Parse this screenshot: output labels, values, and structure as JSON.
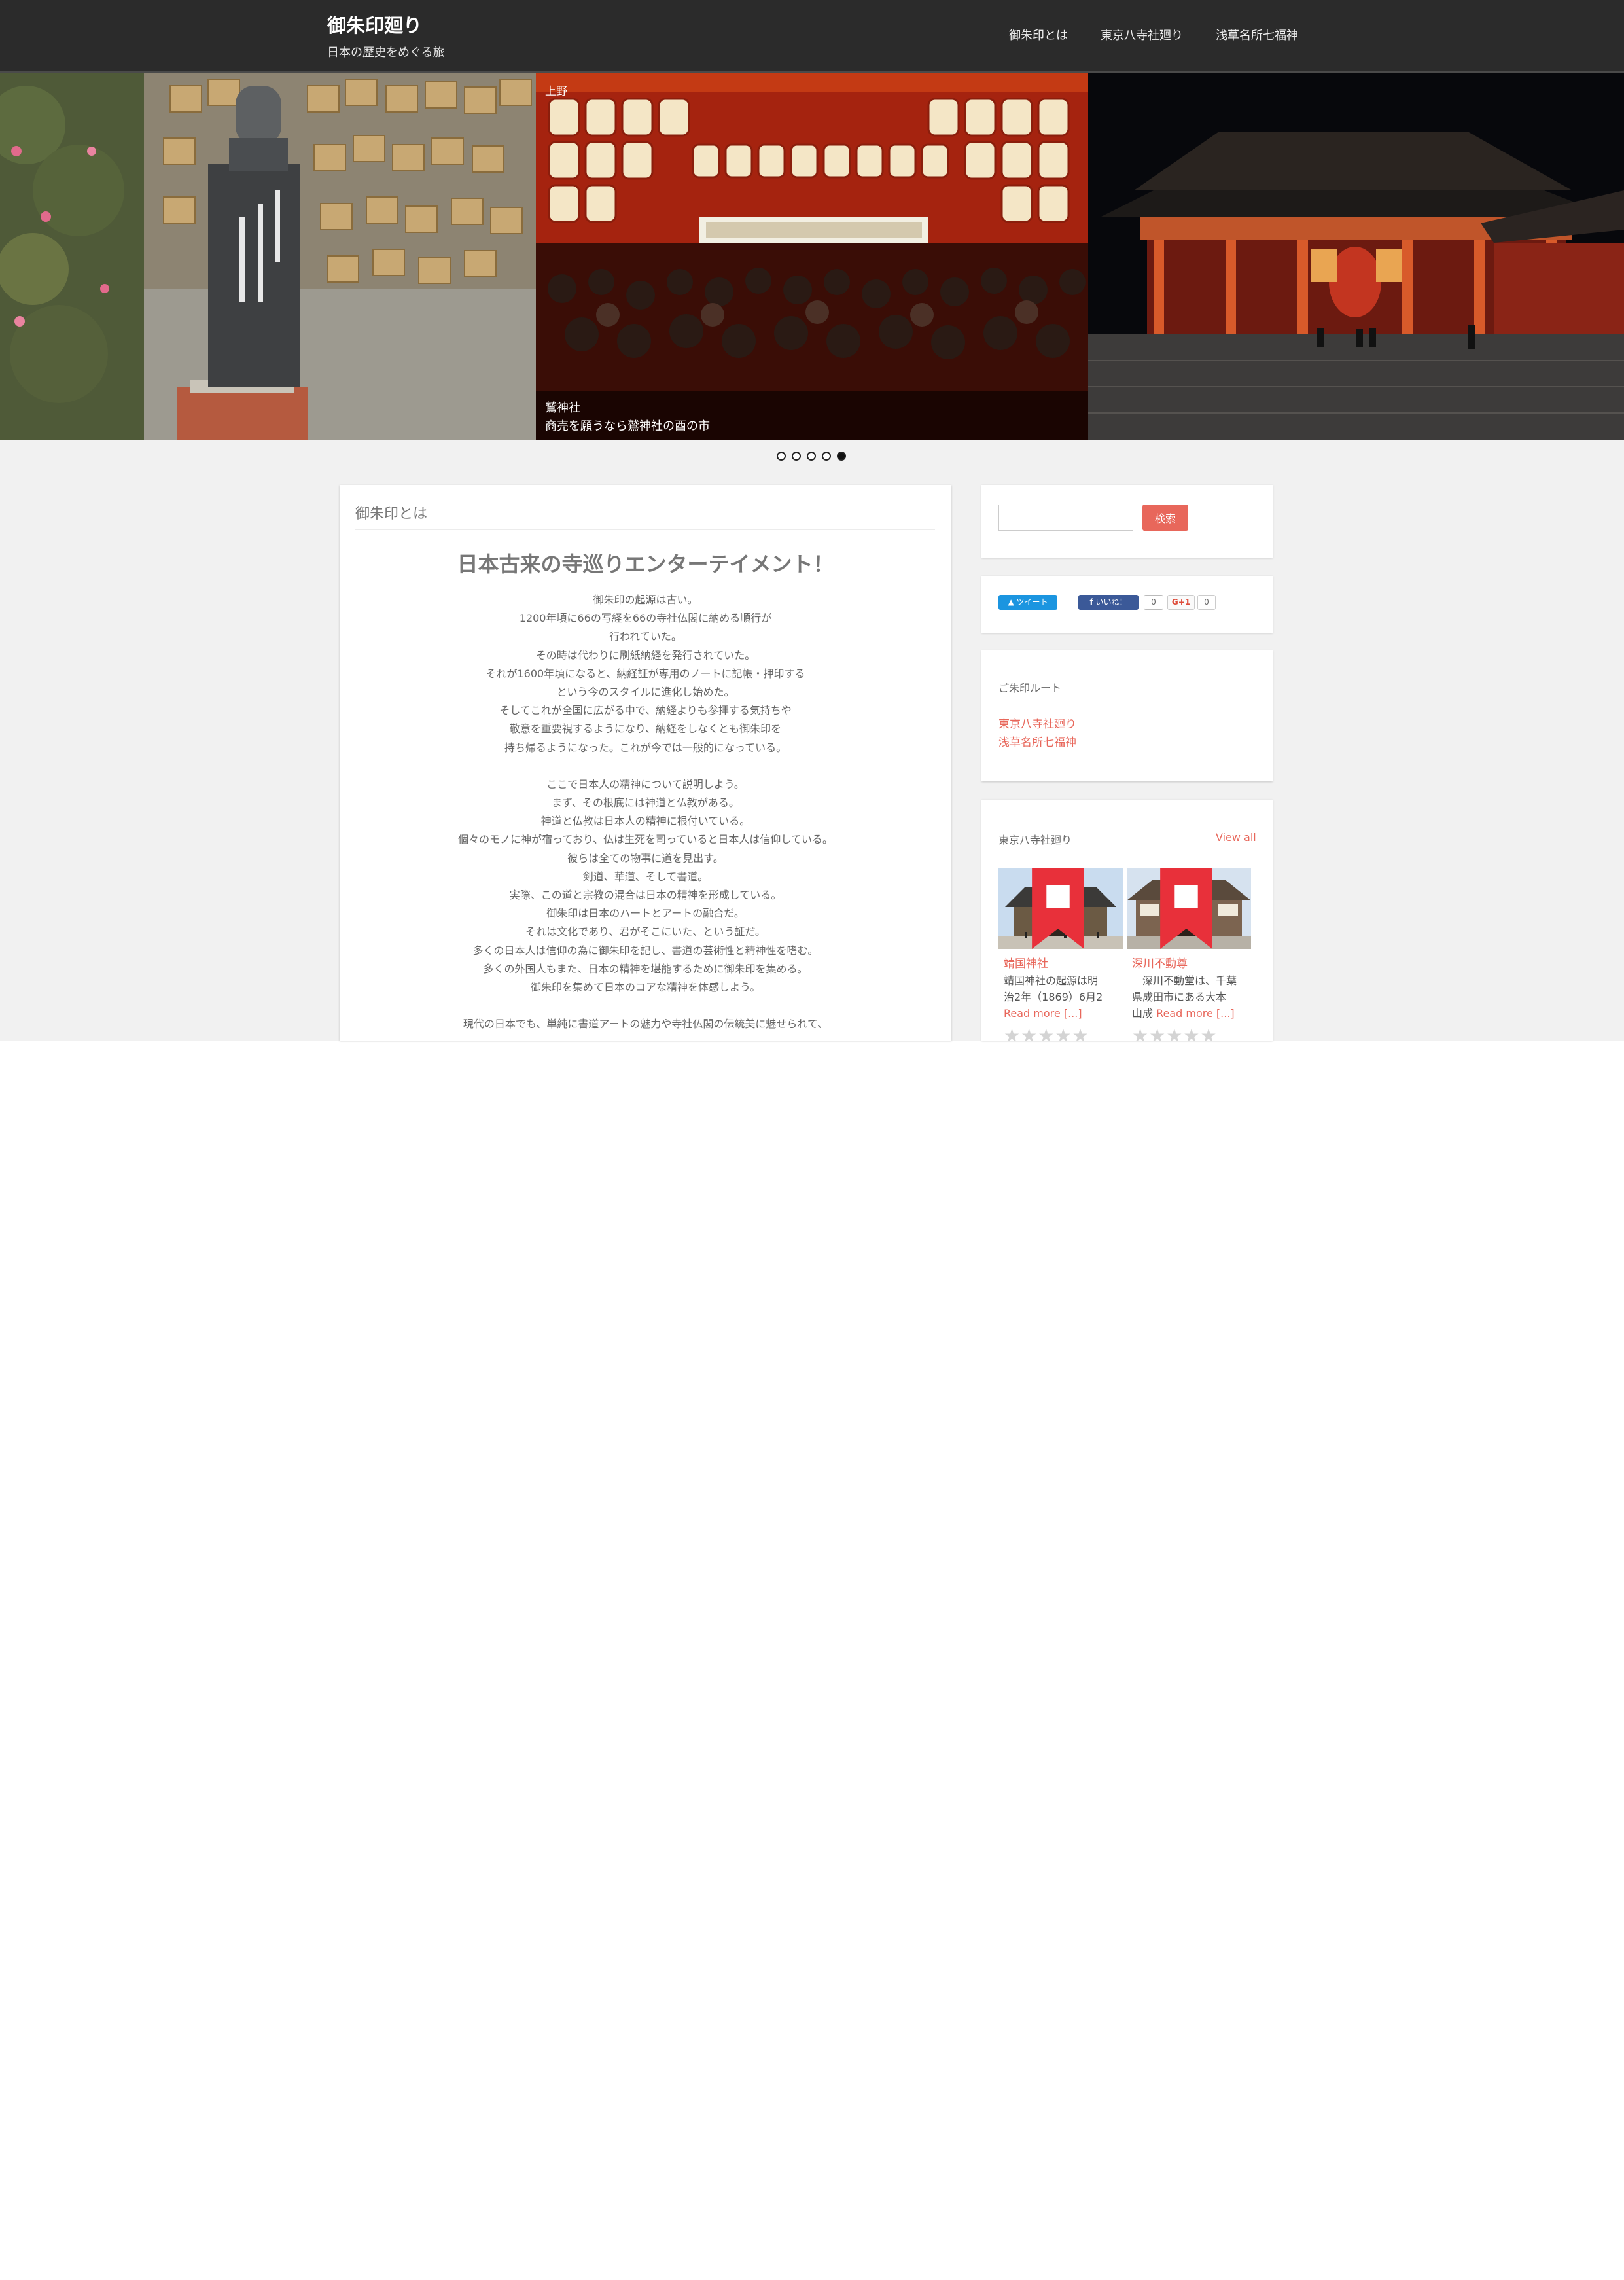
{
  "site": {
    "title": "御朱印廻り",
    "description": "日本の歴史をめぐる旅"
  },
  "nav": {
    "items": [
      {
        "label": "御朱印とは"
      },
      {
        "label": "東京八寺社廻り"
      },
      {
        "label": "浅草名所七福神"
      }
    ]
  },
  "slider": {
    "top_label": "上野",
    "caption_title": "鷲神社",
    "caption_text": "商売を願うなら鷲神社の酉の市",
    "dots": 5,
    "active_dot": 5
  },
  "article": {
    "title": "御朱印とは",
    "heading": "日本古来の寺巡りエンターテイメント！",
    "paragraphs": [
      [
        "御朱印の起源は古い。",
        "1200年頃に66の写経を66の寺社仏閣に納める順行が",
        "行われていた。",
        "その時は代わりに刷紙納経を発行されていた。",
        "それが1600年頃になると、納経証が専用のノートに記帳・押印する",
        "という今のスタイルに進化し始めた。",
        "そしてこれが全国に広がる中で、納経よりも参拝する気持ちや",
        "敬意を重要視するようになり、納経をしなくとも御朱印を",
        "持ち帰るようになった。これが今では一般的になっている。"
      ],
      [
        "ここで日本人の精神について説明しよう。",
        "まず、その根底には神道と仏教がある。",
        "神道と仏教は日本人の精神に根付いている。",
        "個々のモノに神が宿っており、仏は生死を司っていると日本人は信仰している。",
        "彼らは全ての物事に道を見出す。",
        "剣道、華道、そして書道。",
        "実際、この道と宗教の混合は日本の精神を形成している。",
        "御朱印は日本のハートとアートの融合だ。",
        "それは文化であり、君がそこにいた、という証だ。",
        "多くの日本人は信仰の為に御朱印を記し、書道の芸術性と精神性を嗜む。",
        "多くの外国人もまた、日本の精神を堪能するために御朱印を集める。",
        "御朱印を集めて日本のコアな精神を体感しよう。"
      ],
      [
        "現代の日本でも、単純に書道アートの魅力や寺社仏閣の伝統美に魅せられて、"
      ]
    ]
  },
  "sidebar": {
    "search": {
      "placeholder": "",
      "button_label": "検索"
    },
    "share": {
      "tweet_label": "ツイート",
      "like_label": "いいね！",
      "like_count": "0",
      "gplus_label": "G+1",
      "gplus_count": "0"
    },
    "routes": {
      "title": "ご朱印ルート",
      "links": [
        "東京八寺社廻り",
        "浅草名所七福神"
      ]
    },
    "temples": {
      "title": "東京八寺社廻り",
      "view_all": "View all",
      "cards": [
        {
          "title": "靖国神社",
          "excerpt_lines": [
            "靖国神社の起源は明",
            "治2年（1869）6月2"
          ],
          "more": "Read more [...]",
          "rating": 0,
          "badge_icon": "bookmark-icon"
        },
        {
          "title": "深川不動尊",
          "excerpt_lines": [
            "　深川不動堂は、千葉",
            "県成田市にある大本"
          ],
          "excerpt_tail": "山成",
          "more": "Read more [...]",
          "rating": 0,
          "badge_icon": "bookmark-icon"
        }
      ]
    }
  },
  "colors": {
    "header_bg": "#2b2b2b",
    "accent": "#e8675b",
    "page_bg": "#f1f1f1",
    "twitter": "#1b95e0",
    "facebook": "#3b5998"
  }
}
